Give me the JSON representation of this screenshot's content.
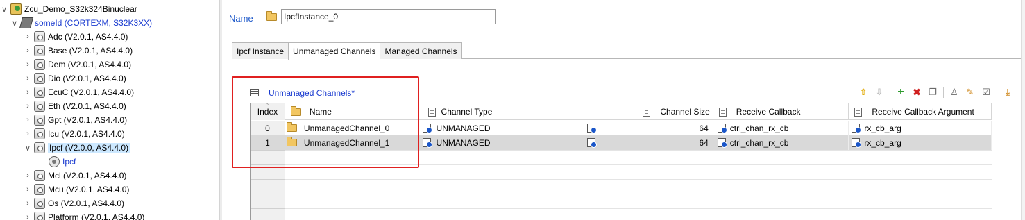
{
  "tree": {
    "project": "Zcu_Demo_S32k324Binuclear",
    "target": "someId (CORTEXM, S32K3XX)",
    "modules": [
      {
        "label": "Adc (V2.0.1, AS4.4.0)"
      },
      {
        "label": "Base (V2.0.1, AS4.4.0)"
      },
      {
        "label": "Dem (V2.0.1, AS4.4.0)"
      },
      {
        "label": "Dio (V2.0.1, AS4.4.0)"
      },
      {
        "label": "EcuC (V2.0.1, AS4.4.0)"
      },
      {
        "label": "Eth (V2.0.1, AS4.4.0)"
      },
      {
        "label": "Gpt (V2.0.1, AS4.4.0)"
      },
      {
        "label": "Icu (V2.0.1, AS4.4.0)"
      },
      {
        "label": "Ipcf (V2.0.0, AS4.4.0)"
      },
      {
        "label": "Mcl (V2.0.1, AS4.4.0)"
      },
      {
        "label": "Mcu (V2.0.1, AS4.4.0)"
      },
      {
        "label": "Os (V2.0.1, AS4.4.0)"
      },
      {
        "label": "Platform (V2.0.1, AS4.4.0)"
      }
    ],
    "ipcf_child": "Ipcf"
  },
  "editor": {
    "name_label": "Name",
    "name_value": "IpcfInstance_0",
    "tabs": [
      "Ipcf Instance",
      "Unmanaged Channels",
      "Managed Channels"
    ],
    "section_title": "Unmanaged Channels*"
  },
  "table": {
    "headers": {
      "index": "Index",
      "name": "Name",
      "channel_type": "Channel Type",
      "channel_size": "Channel Size",
      "receive_callback": "Receive Callback",
      "receive_callback_argument": "Receive Callback Argument"
    },
    "rows": [
      {
        "index": "0",
        "name": "UnmanagedChannel_0",
        "channel_type": "UNMANAGED",
        "channel_size": "64",
        "receive_callback": "ctrl_chan_rx_cb",
        "receive_callback_argument": "rx_cb_arg"
      },
      {
        "index": "1",
        "name": "UnmanagedChannel_1",
        "channel_type": "UNMANAGED",
        "channel_size": "64",
        "receive_callback": "ctrl_chan_rx_cb",
        "receive_callback_argument": "rx_cb_arg"
      }
    ]
  },
  "toolbar_icons": [
    "move-up-icon",
    "move-down-icon",
    "add-icon",
    "delete-icon",
    "copy-icon",
    "user-icon",
    "edit-icon",
    "properties-icon",
    "import-icon"
  ],
  "colors": {
    "accent": "#1a3bd0",
    "selection": "#cce8ff",
    "highlight_box": "#e02020",
    "row_selected": "#d9d9d9"
  }
}
